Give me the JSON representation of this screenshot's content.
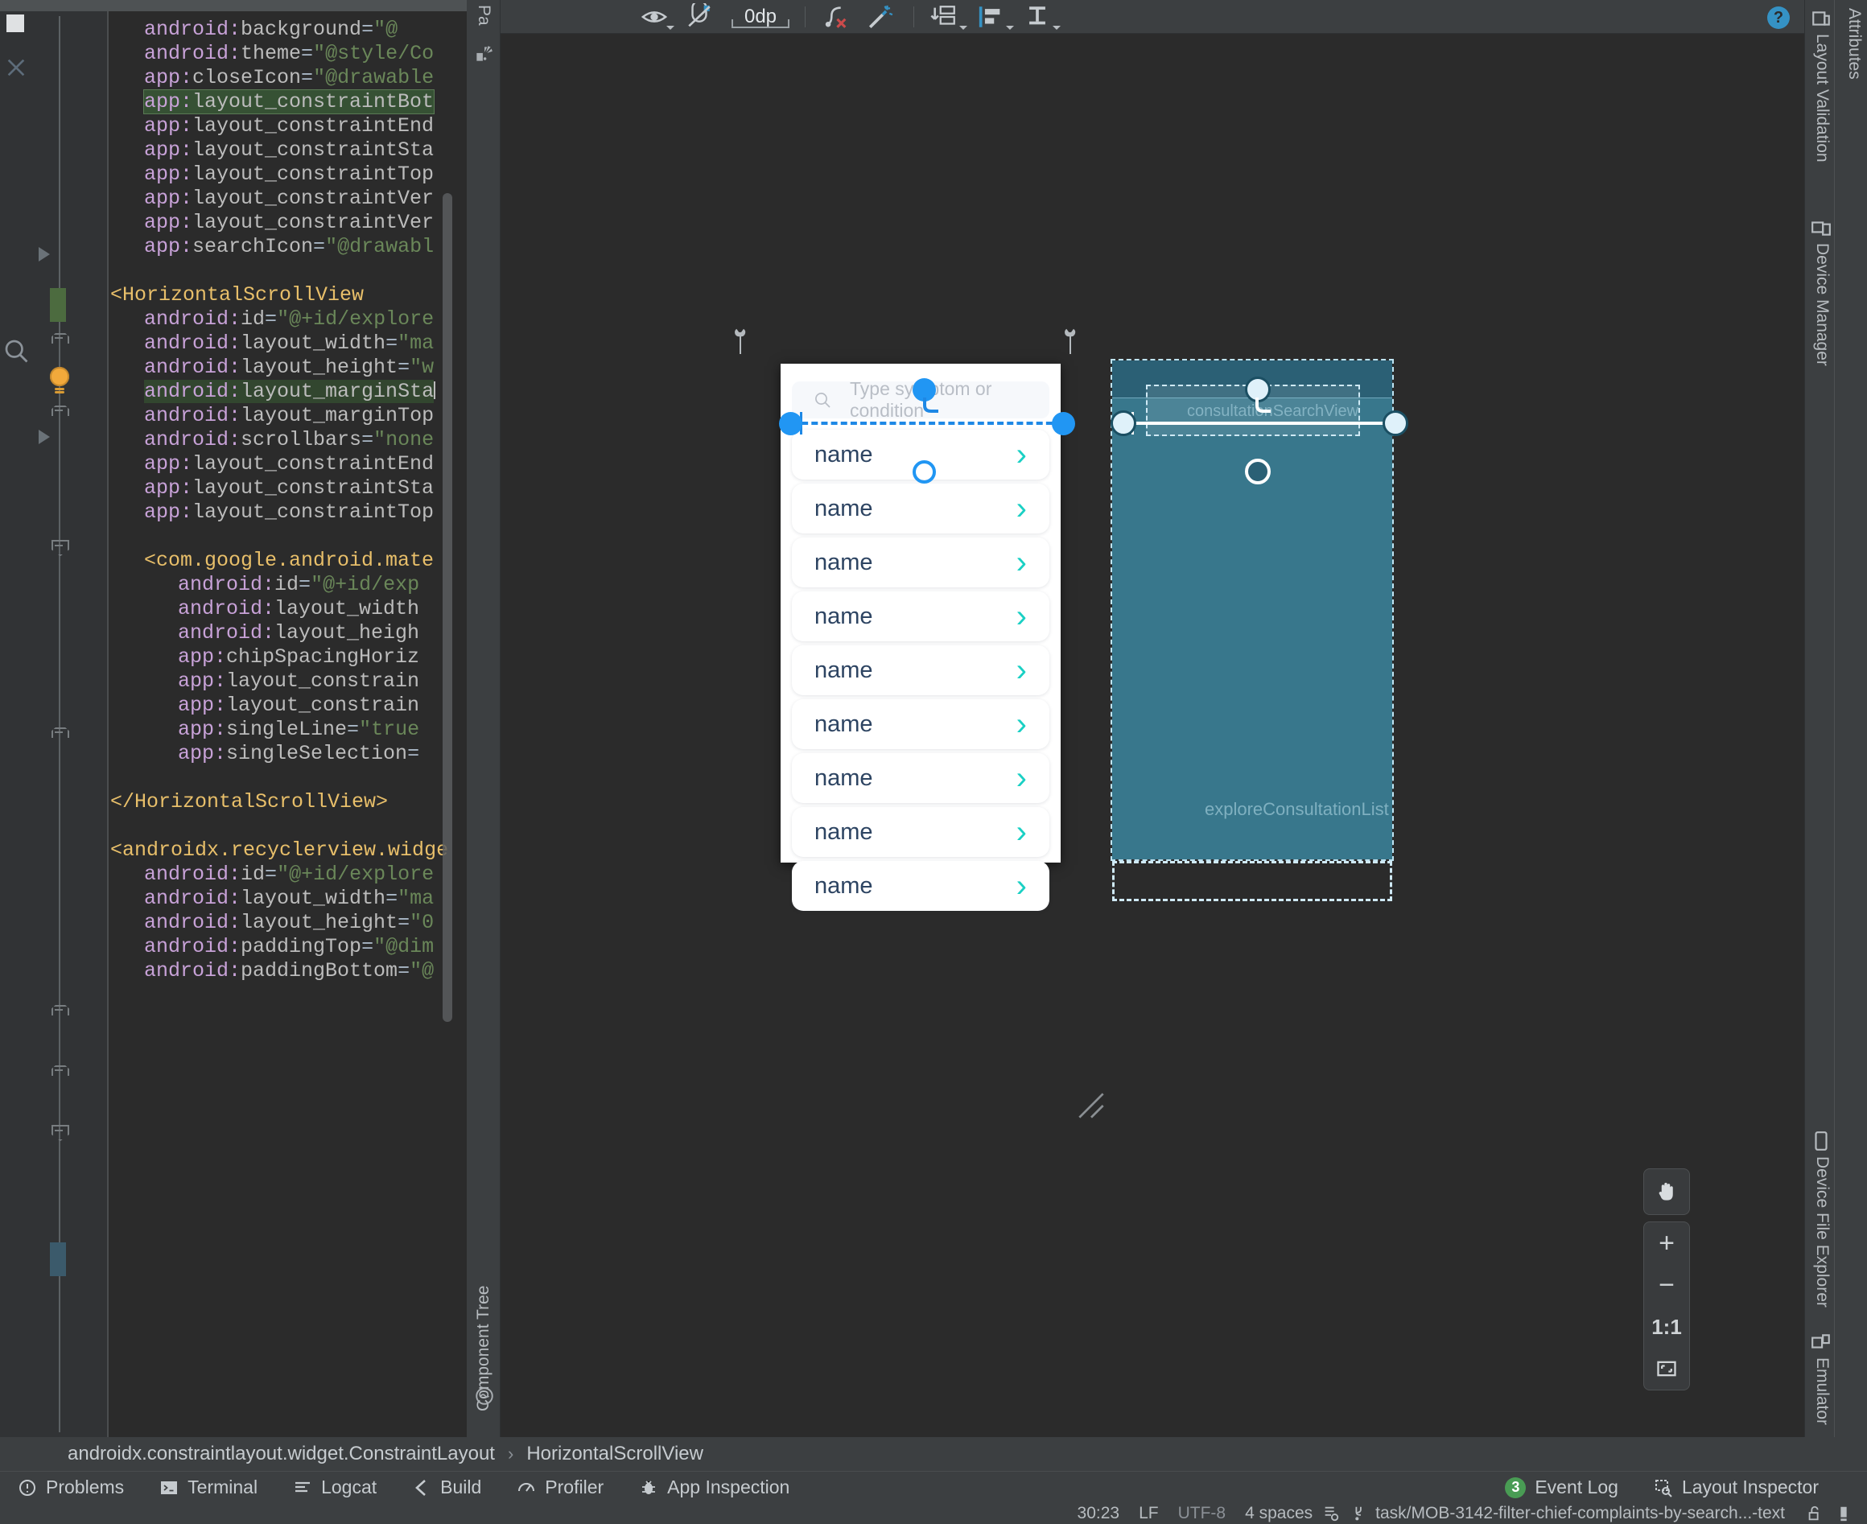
{
  "app": {
    "editor_filetype": "xml-layout"
  },
  "code": {
    "lines": [
      {
        "indent": 1,
        "text": "android:background=\"@",
        "kind": "attr"
      },
      {
        "indent": 1,
        "text": "android:theme=\"@style/Co",
        "kind": "attr"
      },
      {
        "indent": 1,
        "text": "app:closeIcon=\"@drawable",
        "kind": "attr"
      },
      {
        "indent": 1,
        "text": "app:layout_constraintBot",
        "kind": "attr",
        "highlight": true
      },
      {
        "indent": 1,
        "text": "app:layout_constraintEnd",
        "kind": "attr"
      },
      {
        "indent": 1,
        "text": "app:layout_constraintSta",
        "kind": "attr"
      },
      {
        "indent": 1,
        "text": "app:layout_constraintTop",
        "kind": "attr"
      },
      {
        "indent": 1,
        "text": "app:layout_constraintVer",
        "kind": "attr"
      },
      {
        "indent": 1,
        "text": "app:layout_constraintVer",
        "kind": "attr"
      },
      {
        "indent": 1,
        "text": "app:searchIcon=\"@drawabl",
        "kind": "attr"
      },
      {
        "indent": 0,
        "text": "",
        "kind": "blank"
      },
      {
        "indent": 0,
        "text": "<HorizontalScrollView",
        "kind": "tag"
      },
      {
        "indent": 1,
        "text": "android:id=\"@+id/explore",
        "kind": "attr"
      },
      {
        "indent": 1,
        "text": "android:layout_width=\"ma",
        "kind": "attr"
      },
      {
        "indent": 1,
        "text": "android:layout_height=\"w",
        "kind": "attr"
      },
      {
        "indent": 1,
        "text": "android:layout_marginSta",
        "kind": "attr",
        "highlight_soft": true,
        "caret": true
      },
      {
        "indent": 1,
        "text": "android:layout_marginTop",
        "kind": "attr"
      },
      {
        "indent": 1,
        "text": "android:scrollbars=\"none",
        "kind": "attr"
      },
      {
        "indent": 1,
        "text": "app:layout_constraintEnd",
        "kind": "attr"
      },
      {
        "indent": 1,
        "text": "app:layout_constraintSta",
        "kind": "attr"
      },
      {
        "indent": 1,
        "text": "app:layout_constraintTop",
        "kind": "attr"
      },
      {
        "indent": 0,
        "text": "",
        "kind": "blank"
      },
      {
        "indent": 1,
        "text": "<com.google.android.mate",
        "kind": "tag"
      },
      {
        "indent": 2,
        "text": "android:id=\"@+id/exp",
        "kind": "attr"
      },
      {
        "indent": 2,
        "text": "android:layout_width",
        "kind": "attr"
      },
      {
        "indent": 2,
        "text": "android:layout_heigh",
        "kind": "attr"
      },
      {
        "indent": 2,
        "text": "app:chipSpacingHoriz",
        "kind": "attr"
      },
      {
        "indent": 2,
        "text": "app:layout_constrain",
        "kind": "attr"
      },
      {
        "indent": 2,
        "text": "app:layout_constrain",
        "kind": "attr"
      },
      {
        "indent": 2,
        "text": "app:singleLine=\"true",
        "kind": "attr"
      },
      {
        "indent": 2,
        "text": "app:singleSelection=",
        "kind": "attr"
      },
      {
        "indent": 0,
        "text": "",
        "kind": "blank"
      },
      {
        "indent": 0,
        "text": "</HorizontalScrollView>",
        "kind": "tag"
      },
      {
        "indent": 0,
        "text": "",
        "kind": "blank"
      },
      {
        "indent": 0,
        "text": "<androidx.recyclerview.widge",
        "kind": "tag"
      },
      {
        "indent": 1,
        "text": "android:id=\"@+id/explore",
        "kind": "attr"
      },
      {
        "indent": 1,
        "text": "android:layout_width=\"ma",
        "kind": "attr"
      },
      {
        "indent": 1,
        "text": "android:layout_height=\"0",
        "kind": "attr"
      },
      {
        "indent": 1,
        "text": "android:paddingTop=\"@dim",
        "kind": "attr"
      },
      {
        "indent": 1,
        "text": "android:paddingBottom=\"@",
        "kind": "attr"
      }
    ]
  },
  "left_strip": {
    "palette_label": "Pa",
    "component_tree_label": "Component Tree"
  },
  "design_toolbar": {
    "items": [
      {
        "name": "view-options-icon",
        "icon": "eye"
      },
      {
        "name": "toggle-constraints-icon",
        "icon": "magnet-off"
      },
      {
        "name": "default-margin-value",
        "icon": "text",
        "label": "0dp"
      },
      {
        "name": "clear-constraints-icon",
        "icon": "clear-constraints"
      },
      {
        "name": "infer-constraints-icon",
        "icon": "magic-wand"
      },
      {
        "name": "pack-icon",
        "icon": "pack"
      },
      {
        "name": "align-icon",
        "icon": "align"
      },
      {
        "name": "guidelines-icon",
        "icon": "guidelines"
      }
    ],
    "help_label": "?"
  },
  "preview": {
    "search": {
      "placeholder": "Type symptom or condition",
      "icon": "search-icon"
    },
    "list_items": [
      {
        "label": "name"
      },
      {
        "label": "name"
      },
      {
        "label": "name"
      },
      {
        "label": "name"
      },
      {
        "label": "name"
      },
      {
        "label": "name"
      },
      {
        "label": "name"
      },
      {
        "label": "name"
      },
      {
        "label": "name"
      }
    ],
    "chevron_color": "#1ad0c4",
    "label_color": "#2d4462"
  },
  "blueprint": {
    "search_view_label": "consultationSearchView",
    "list_label": "exploreConsultationList",
    "fill_color": "#38778c",
    "dark_fill_color": "#2b6075"
  },
  "zoom_controls": {
    "pan_label": "pan-hand",
    "zoom_in": "+",
    "zoom_out": "−",
    "actual_size": "1:1",
    "fit_screen": "fit-icon"
  },
  "right_strip": {
    "tabs": [
      {
        "label": "Attributes",
        "icon": "attributes-icon"
      },
      {
        "label": "Layout Validation",
        "icon": "layout-validation-icon"
      },
      {
        "label": "Device Manager",
        "icon": "device-manager-icon"
      },
      {
        "label": "Device File Explorer",
        "icon": "device-file-explorer-icon"
      },
      {
        "label": "Emulator",
        "icon": "emulator-icon"
      }
    ]
  },
  "breadcrumb": {
    "items": [
      "androidx.constraintlayout.widget.ConstraintLayout",
      "HorizontalScrollView"
    ],
    "separator": "›"
  },
  "tool_windows": {
    "left": [
      {
        "label": "Problems",
        "icon": "problems-icon"
      },
      {
        "label": "Terminal",
        "icon": "terminal-icon"
      },
      {
        "label": "Logcat",
        "icon": "logcat-icon"
      },
      {
        "label": "Build",
        "icon": "build-icon"
      },
      {
        "label": "Profiler",
        "icon": "profiler-icon"
      },
      {
        "label": "App Inspection",
        "icon": "app-inspection-icon"
      }
    ],
    "right": [
      {
        "label": "Event Log",
        "icon": "event-log-icon",
        "badge": "3"
      },
      {
        "label": "Layout Inspector",
        "icon": "layout-inspector-icon"
      }
    ]
  },
  "status_bar": {
    "caret_position": "30:23",
    "line_separator": "LF",
    "encoding": "UTF-8",
    "indent": "4 spaces",
    "indent_icon": "indent-config-icon",
    "branch_icon": "branch-icon",
    "branch": "task/MOB-3142-filter-chief-complaints-by-search...-text",
    "lock_icon": "unlocked-icon",
    "notify_icon": "notification-icon"
  }
}
